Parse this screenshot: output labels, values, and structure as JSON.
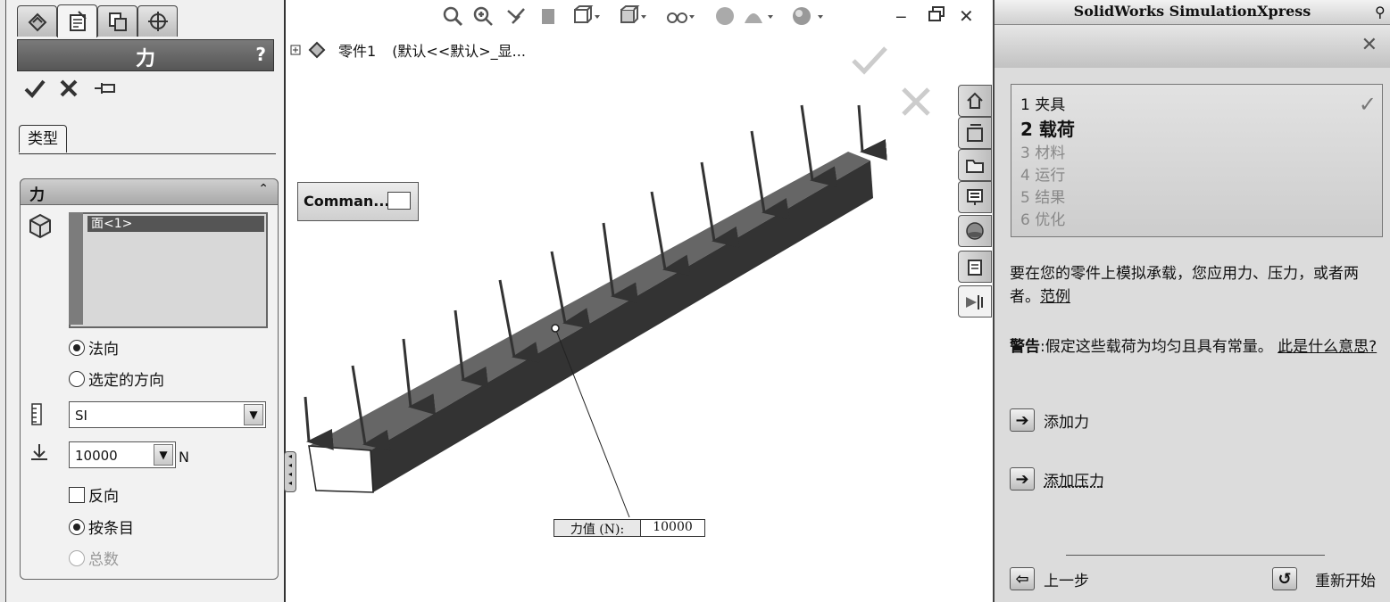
{
  "pm": {
    "title": "力",
    "help": "?",
    "type_tab": "类型",
    "group_title": "力",
    "selection_item": "面<1>",
    "radio_normal": "法向",
    "radio_selected_dir": "选定的方向",
    "unit_system": "SI",
    "force_value": "10000",
    "force_unit": "N",
    "reverse": "反向",
    "per_item": "按条目",
    "total": "总数"
  },
  "graphics": {
    "tree_label": "零件1",
    "tree_config": "(默认<<默认>_显...",
    "command_label": "Comman...",
    "callout_label": "力值 (N):",
    "callout_value": "10000"
  },
  "right": {
    "title": "SolidWorks SimulationXpress",
    "steps": [
      {
        "num": "1",
        "label": "夹具"
      },
      {
        "num": "2",
        "label": "载荷"
      },
      {
        "num": "3",
        "label": "材料"
      },
      {
        "num": "4",
        "label": "运行"
      },
      {
        "num": "5",
        "label": "结果"
      },
      {
        "num": "6",
        "label": "优化"
      }
    ],
    "intro": "要在您的零件上模拟承载，您应用力、压力，或者两者。",
    "intro_link": "范例",
    "warning_bold": "警告",
    "warning_text": ":假定这些载荷为均匀且具有常量。",
    "warning_link": "此是什么意思?",
    "add_force": "添加力",
    "add_pressure": "添加压力",
    "back": "上一步",
    "restart": "重新开始"
  }
}
